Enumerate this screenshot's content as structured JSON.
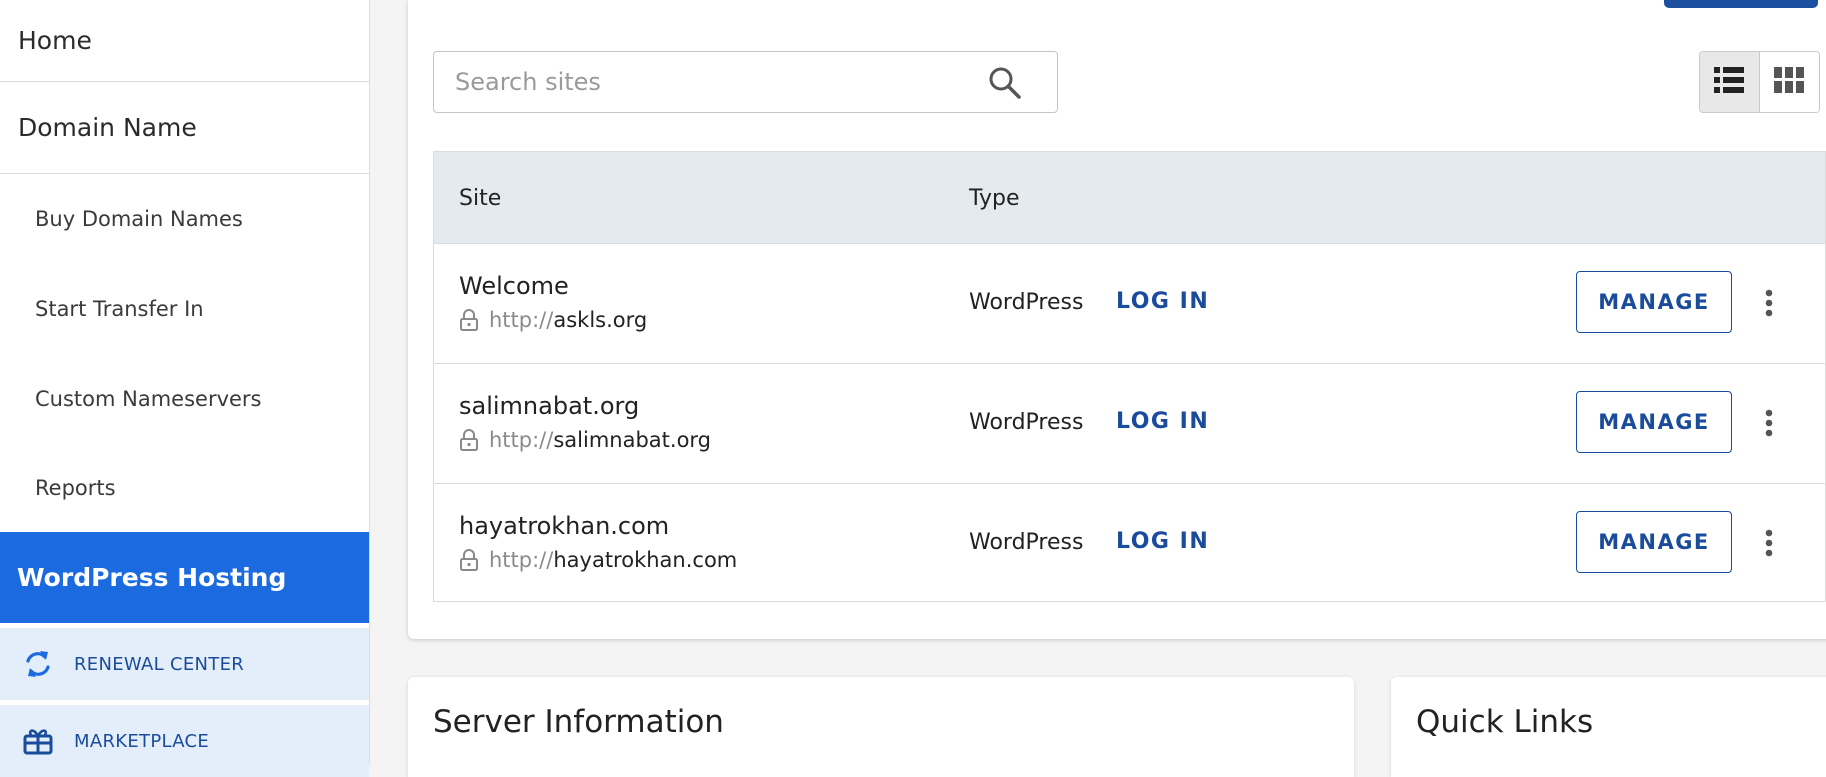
{
  "sidebar": {
    "home": "Home",
    "domain_name": "Domain Name",
    "sub_items": [
      {
        "label": "Buy Domain Names"
      },
      {
        "label": "Start Transfer In"
      },
      {
        "label": "Custom Nameservers"
      },
      {
        "label": "Reports"
      }
    ],
    "active": "WordPress Hosting",
    "utility": [
      {
        "label": "RENEWAL CENTER",
        "icon": "refresh-icon"
      },
      {
        "label": "MARKETPLACE",
        "icon": "gift-icon"
      }
    ]
  },
  "search": {
    "placeholder": "Search sites"
  },
  "view_toggle": {
    "active": "list-view",
    "options": [
      "list-view-icon",
      "grid-view-icon"
    ]
  },
  "table": {
    "headers": {
      "site": "Site",
      "type": "Type"
    },
    "rows": [
      {
        "name": "Welcome",
        "url_proto": "http://",
        "url_host": "askls.org",
        "type": "WordPress",
        "login": "LOG IN",
        "manage": "MANAGE"
      },
      {
        "name": "salimnabat.org",
        "url_proto": "http://",
        "url_host": "salimnabat.org",
        "type": "WordPress",
        "login": "LOG IN",
        "manage": "MANAGE"
      },
      {
        "name": "hayatrokhan.com",
        "url_proto": "http://",
        "url_host": "hayatrokhan.com",
        "type": "WordPress",
        "login": "LOG IN",
        "manage": "MANAGE"
      }
    ]
  },
  "cards": {
    "server_information": "Server Information",
    "quick_links": "Quick Links"
  },
  "colors": {
    "accent": "#1b6ae0",
    "link": "#1a4c9c",
    "table_header_bg": "#e4eaee",
    "utility_bg": "#e4eefb"
  }
}
